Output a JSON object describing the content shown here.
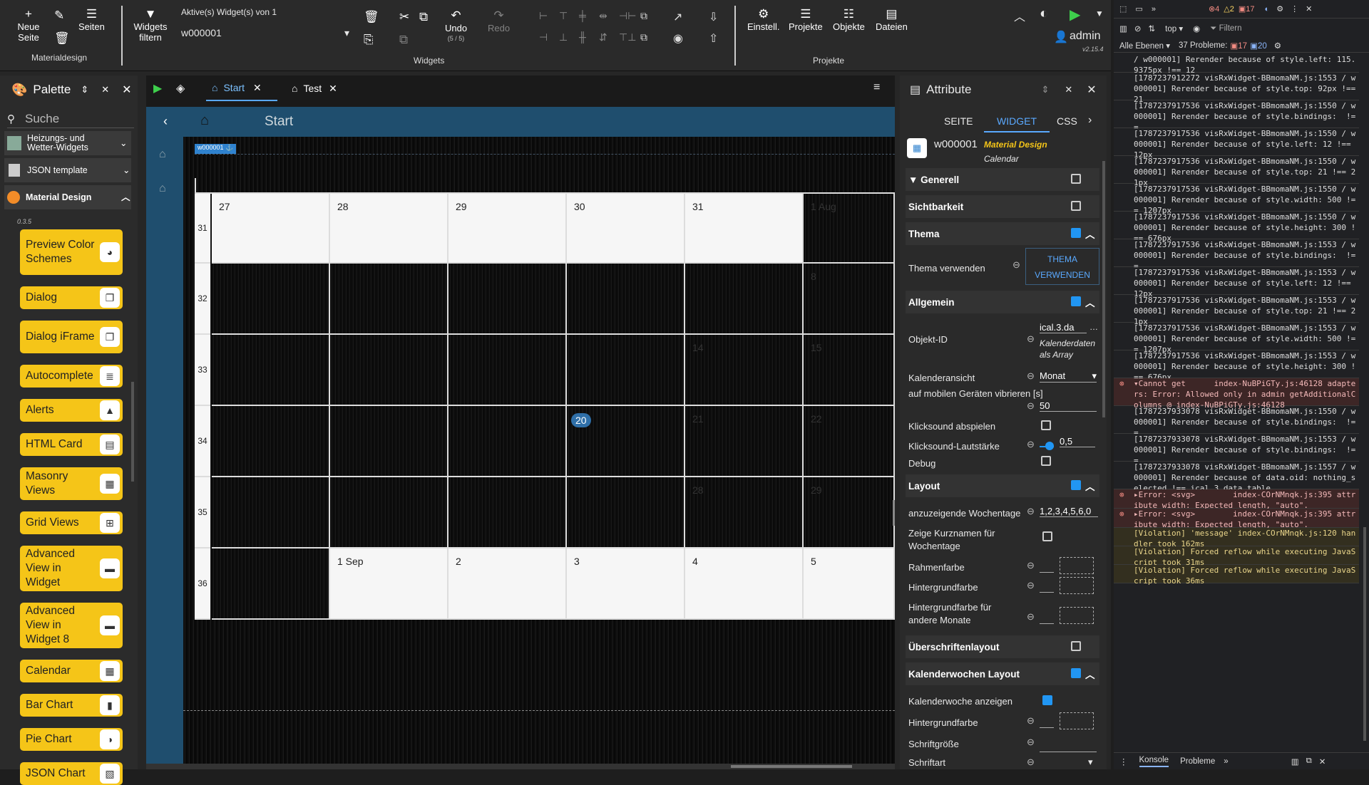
{
  "toolbar": {
    "neue_seite": "Neue Seite",
    "seiten": "Seiten",
    "materialdesign": "Materialdesign",
    "widgets_filtern": "Widgets filtern",
    "active_widgets": "Aktive(s) Widget(s) von 1",
    "widget_select": "w000001",
    "undo": "Undo",
    "undo_count": "(5 / 5)",
    "redo": "Redo",
    "widgets_group": "Widgets",
    "einstell": "Einstell.",
    "projekte": "Projekte",
    "objekte": "Objekte",
    "dateien": "Dateien",
    "projekte_group": "Projekte",
    "user": "admin",
    "version": "v2.15.4"
  },
  "palette": {
    "title": "Palette",
    "search_placeholder": "Suche",
    "categories": [
      {
        "label": "Heizungs- und Wetter-Widgets"
      },
      {
        "label": "JSON template"
      },
      {
        "label": "Material Design"
      }
    ],
    "md_version": "0.3.5",
    "items": [
      {
        "label": "Preview Color Schemes",
        "icon": "palette-icon"
      },
      {
        "label": "Dialog",
        "icon": "dialog-icon"
      },
      {
        "label": "Dialog iFrame",
        "icon": "dialog-iframe-icon"
      },
      {
        "label": "Autocomplete",
        "icon": "autocomplete-icon"
      },
      {
        "label": "Alerts",
        "icon": "alert-icon"
      },
      {
        "label": "HTML Card",
        "icon": "card-icon"
      },
      {
        "label": "Masonry Views",
        "icon": "masonry-icon"
      },
      {
        "label": "Grid Views",
        "icon": "grid-icon"
      },
      {
        "label": "Advanced View in Widget",
        "icon": "view-icon"
      },
      {
        "label": "Advanced View in Widget 8",
        "icon": "view8-icon"
      },
      {
        "label": "Calendar",
        "icon": "calendar-icon"
      },
      {
        "label": "Bar Chart",
        "icon": "bar-chart-icon"
      },
      {
        "label": "Pie Chart",
        "icon": "pie-chart-icon"
      },
      {
        "label": "JSON Chart",
        "icon": "json-chart-icon"
      }
    ]
  },
  "editor": {
    "tabs": [
      {
        "label": "Start"
      },
      {
        "label": "Test"
      }
    ],
    "view_title": "Start",
    "widget_tag": "w000001",
    "calendar": {
      "weeks": [
        "31",
        "32",
        "33",
        "34",
        "35",
        "36"
      ],
      "rows": [
        [
          "27",
          "28",
          "29",
          "30",
          "31",
          "1 Aug"
        ],
        [
          "",
          "",
          "",
          "",
          "",
          "8"
        ],
        [
          "",
          "",
          "",
          "",
          "14",
          "15"
        ],
        [
          "",
          "",
          "",
          "20",
          "21",
          "22"
        ],
        [
          "",
          "",
          "",
          "",
          "28",
          "29"
        ],
        [
          "",
          "1 Sep",
          "2",
          "3",
          "4",
          "5"
        ]
      ],
      "today": "20"
    }
  },
  "attributes": {
    "title": "Attribute",
    "tabs": [
      "SEITE",
      "WIDGET",
      "CSS"
    ],
    "widget_id": "w000001",
    "widget_set": "Material Design",
    "widget_type": "Calendar",
    "sections": {
      "generell": "Generell",
      "sichtbarkeit": "Sichtbarkeit",
      "thema": "Thema",
      "allgemein": "Allgemein",
      "layout": "Layout",
      "ueberschriften": "Überschriftenlayout",
      "kalenderwochen": "Kalenderwochen Layout"
    },
    "thema_verwenden_label": "Thema verwenden",
    "thema_button": "THEMA VERWENDEN",
    "objekt_id_label": "Objekt-ID",
    "objekt_id_value": "ical.3.da",
    "objekt_id_hint": "Kalenderdaten als Array",
    "kalenderansicht_label": "Kalenderansicht",
    "kalenderansicht_value": "Monat",
    "vibrieren_label": "auf mobilen Geräten vibrieren [s]",
    "vibrieren_value": "50",
    "klicksound_label": "Klicksound abspielen",
    "lautstaerke_label": "Klicksound-Lautstärke",
    "lautstaerke_value": "0,5",
    "debug_label": "Debug",
    "wochentage_label": "anzuzeigende Wochentage",
    "wochentage_value": "1,2,3,4,5,6,0",
    "kurznamen_label": "Zeige Kurznamen für Wochentage",
    "rahmenfarbe_label": "Rahmenfarbe",
    "hintergrundfarbe_label": "Hintergrundfarbe",
    "hintergrund_andere_label": "Hintergrundfarbe für andere Monate",
    "kw_anzeigen_label": "Kalenderwoche anzeigen",
    "kw_hintergrund_label": "Hintergrundfarbe",
    "schriftgroesse_label": "Schriftgröße",
    "schriftart_label": "Schriftart"
  },
  "devtools": {
    "errors_count": "4",
    "warnings_count": "2",
    "issues_count": "17",
    "context": "top",
    "filter": "Filtern",
    "levels": "Alle Ebenen",
    "problems": "37 Probleme:",
    "problems_err": "17",
    "problems_info": "20",
    "tab_console": "Konsole",
    "tab_problems": "Probleme",
    "logs": [
      {
        "text": "/ w000001] Rerender because of style.left: 115.9375px !== 12",
        "type": "log"
      },
      {
        "text": "[1787237912272 visRxWidget-BBmomaNM.js:1553 / w000001] Rerender because of style.top: 92px !== 21",
        "type": "log"
      },
      {
        "text": "[1787237917536 visRxWidget-BBmomaNM.js:1550 / w000001] Rerender because of style.bindings:  !==",
        "type": "log"
      },
      {
        "text": "[1787237917536 visRxWidget-BBmomaNM.js:1550 / w000001] Rerender because of style.left: 12 !== 12px",
        "type": "log"
      },
      {
        "text": "[1787237917536 visRxWidget-BBmomaNM.js:1550 / w000001] Rerender because of style.top: 21 !== 21px",
        "type": "log"
      },
      {
        "text": "[1787237917536 visRxWidget-BBmomaNM.js:1550 / w000001] Rerender because of style.width: 500 !== 1207px",
        "type": "log"
      },
      {
        "text": "[1787237917536 visRxWidget-BBmomaNM.js:1550 / w000001] Rerender because of style.height: 300 !== 676px",
        "type": "log"
      },
      {
        "text": "[1787237917536 visRxWidget-BBmomaNM.js:1553 / w000001] Rerender because of style.bindings:  !==",
        "type": "log"
      },
      {
        "text": "[1787237917536 visRxWidget-BBmomaNM.js:1553 / w000001] Rerender because of style.left: 12 !== 12px",
        "type": "log"
      },
      {
        "text": "[1787237917536 visRxWidget-BBmomaNM.js:1553 / w000001] Rerender because of style.top: 21 !== 21px",
        "type": "log"
      },
      {
        "text": "[1787237917536 visRxWidget-BBmomaNM.js:1553 / w000001] Rerender because of style.width: 500 !== 1207px",
        "type": "log"
      },
      {
        "text": "[1787237917536 visRxWidget-BBmomaNM.js:1553 / w000001] Rerender because of style.height: 300 !== 676px",
        "type": "log"
      },
      {
        "text": "▾Cannot get      index-NuBPiGTy.js:46128 adapters: Error: Allowed only in admin getAdditionalColumns @ index-NuBPiGTy.js:46128",
        "type": "err"
      },
      {
        "text": "[1787237933078 visRxWidget-BBmomaNM.js:1550 / w000001] Rerender because of style.bindings:  !==",
        "type": "log"
      },
      {
        "text": "[1787237933078 visRxWidget-BBmomaNM.js:1553 / w000001] Rerender because of style.bindings:  !==",
        "type": "log"
      },
      {
        "text": "[1787237933078 visRxWidget-BBmomaNM.js:1557 / w000001] Rerender because of data.oid: nothing_selected !== ical.3.data.table",
        "type": "log"
      },
      {
        "text": "▸Error: <svg>        index-COrNMnqk.js:395 attribute width: Expected length, \"auto\".",
        "type": "err"
      },
      {
        "text": "▸Error: <svg>        index-COrNMnqk.js:395 attribute width: Expected length, \"auto\".",
        "type": "err"
      },
      {
        "text": "[Violation] 'message' index-COrNMnqk.js:120 handler took 162ms",
        "type": "warn"
      },
      {
        "text": "[Violation] Forced reflow while executing JavaScript took 31ms",
        "type": "warn"
      },
      {
        "text": "[Violation] Forced reflow while executing JavaScript took 36ms",
        "type": "warn"
      }
    ]
  },
  "colors": {
    "accent": "#f5c518",
    "link_blue": "#2196f3",
    "header_blue": "#1f4e6e"
  }
}
